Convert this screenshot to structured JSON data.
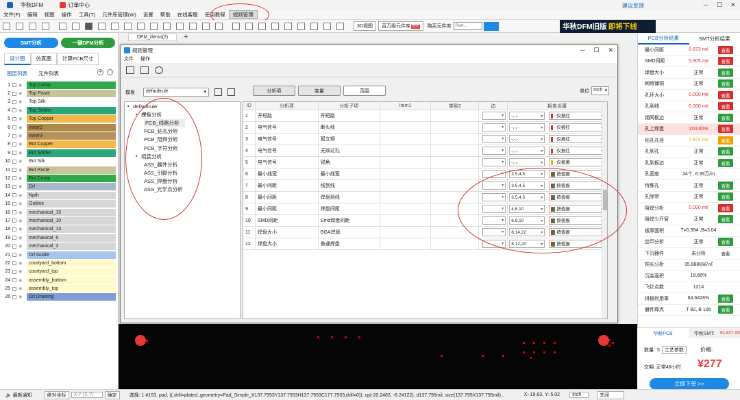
{
  "titlebar": {
    "tab1": "华秋DFM",
    "tab2": "订单中心",
    "feedback": "建议反馈",
    "win": [
      "─",
      "☐",
      "✕"
    ]
  },
  "menu": [
    "文件(F)",
    "编辑",
    "视图",
    "操作",
    "工具(T)",
    "元件库管理(W)",
    "设置",
    "帮助",
    "在线客服",
    "使用教程",
    "规则管理"
  ],
  "toolbar": {
    "btn3d": "3D视图",
    "parts": "百万级元件库",
    "hot": "HOT",
    "buy": "购买元件库",
    "search_ph": "Part..."
  },
  "banner": {
    "part1": "华秋DFM旧版",
    "part2": "即将下线"
  },
  "left": {
    "smt": "SMT分析",
    "dfm": "一键DFM分析",
    "tabs": [
      "设计图",
      "仿真图",
      "计算PCB尺寸"
    ],
    "listtabs": [
      "图层列表",
      "元件列表"
    ],
    "layers": [
      {
        "n": "1",
        "name": "Top Comp",
        "color": "#2eaa4d"
      },
      {
        "n": "2",
        "name": "Top Paste",
        "color": "#c8c49a"
      },
      {
        "n": "3",
        "name": "Top Silk",
        "color": "#ffffff"
      },
      {
        "n": "4",
        "name": "Top Solder",
        "color": "#2aa87a"
      },
      {
        "n": "5",
        "name": "Top Copper",
        "color": "#f4b74a"
      },
      {
        "n": "6",
        "name": "Inner2",
        "color": "#b08a4a"
      },
      {
        "n": "7",
        "name": "Inner3",
        "color": "#b5925a"
      },
      {
        "n": "8",
        "name": "Bot Copper",
        "color": "#f4b74a"
      },
      {
        "n": "9",
        "name": "Bot Solder",
        "color": "#2aa87a"
      },
      {
        "n": "10",
        "name": "Bot Silk",
        "color": "#ffffff"
      },
      {
        "n": "11",
        "name": "Bot Paste",
        "color": "#c8c49a"
      },
      {
        "n": "12",
        "name": "Bot Comp",
        "color": "#2eaa4d"
      },
      {
        "n": "13",
        "name": "Drl",
        "color": "#a9b8c9"
      },
      {
        "n": "14",
        "name": "Npth",
        "color": "#d6d6d6"
      },
      {
        "n": "15",
        "name": "Outline",
        "color": "#d6d6d6"
      },
      {
        "n": "16",
        "name": "mechanical_15",
        "color": "#d6d6d6"
      },
      {
        "n": "17",
        "name": "mechanical_10",
        "color": "#d6d6d6"
      },
      {
        "n": "18",
        "name": "mechanical_13",
        "color": "#d6d6d6"
      },
      {
        "n": "19",
        "name": "mechanical_6",
        "color": "#d6d6d6"
      },
      {
        "n": "20",
        "name": "mechanical_3",
        "color": "#d6d6d6"
      },
      {
        "n": "21",
        "name": "Drl Guide",
        "color": "#a9c4ec"
      },
      {
        "n": "22",
        "name": "courtyard_bottom",
        "color": "#fffbc8"
      },
      {
        "n": "23",
        "name": "courtyard_top",
        "color": "#fffbc8"
      },
      {
        "n": "24",
        "name": "assembly_bottom",
        "color": "#fffbc8"
      },
      {
        "n": "25",
        "name": "assembly_top",
        "color": "#fffbc8"
      },
      {
        "n": "26",
        "name": "Drl Drawing",
        "color": "#7f9ed6"
      }
    ]
  },
  "doc_tab": "DFM_demo(2)",
  "dialog": {
    "title": "规则管理",
    "menu": [
      "文件",
      "操作"
    ],
    "template_label": "模板",
    "template_value": "defaultrule",
    "tabs": [
      "分析项",
      "变量",
      "范围"
    ],
    "unit_label": "单位",
    "unit_value": "Inch",
    "tree": [
      {
        "label": "defaultrule",
        "level": 0,
        "toggle": "▪"
      },
      {
        "label": "裸板分析",
        "level": 1,
        "toggle": "▪"
      },
      {
        "label": "PCB_线路分析",
        "level": 2,
        "sel": true
      },
      {
        "label": "PCB_钻孔分析",
        "level": 2
      },
      {
        "label": "PCB_阻焊分析",
        "level": 2
      },
      {
        "label": "PCB_字符分析",
        "level": 2
      },
      {
        "label": "组装分析",
        "level": 1,
        "toggle": "▪"
      },
      {
        "label": "ASS_器件分析",
        "level": 2
      },
      {
        "label": "ASS_引脚分析",
        "level": 2
      },
      {
        "label": "ASS_焊盘分析",
        "level": 2
      },
      {
        "label": "ASS_光学点分析",
        "level": 2
      }
    ],
    "columns": [
      "ID",
      "分析项",
      "分析子项",
      "Item1",
      "类型2",
      "边",
      "报告设置"
    ],
    "rows": [
      {
        "id": "1",
        "item": "开短路",
        "sub": "开短路",
        "val": "-,-,-",
        "rep": "仅报红",
        "c1": "#d32f2f",
        "c2": ""
      },
      {
        "id": "2",
        "item": "电气信号",
        "sub": "断头线",
        "val": "-,-,-",
        "rep": "仅报红",
        "c1": "#d32f2f",
        "c2": ""
      },
      {
        "id": "3",
        "item": "电气信号",
        "sub": "孤立铜",
        "val": "-,-,-",
        "rep": "仅报红",
        "c1": "#d32f2f",
        "c2": ""
      },
      {
        "id": "4",
        "item": "电气信号",
        "sub": "无效过孔",
        "val": "-,-,-",
        "rep": "仅报红",
        "c1": "#d32f2f",
        "c2": ""
      },
      {
        "id": "5",
        "item": "电气信号",
        "sub": "锐角",
        "val": "-,-,-",
        "rep": "仅报黄",
        "c1": "#e8b400",
        "c2": ""
      },
      {
        "id": "6",
        "item": "最小线宽",
        "sub": "最小线宽",
        "val": "3.5,4,5",
        "rep": "按值报",
        "c1": "#d32f2f",
        "c2": "#e8b400"
      },
      {
        "id": "7",
        "item": "最小间距",
        "sub": "线到线",
        "val": "3.5,4,5",
        "rep": "按值报",
        "c1": "#d32f2f",
        "c2": "#e8b400"
      },
      {
        "id": "8",
        "item": "最小间距",
        "sub": "焊盘到线",
        "val": "3.5,4,5",
        "rep": "按值报",
        "c1": "#d32f2f",
        "c2": "#e8b400"
      },
      {
        "id": "9",
        "item": "最小间距",
        "sub": "焊盘间距",
        "val": "4,6,10",
        "rep": "按值报",
        "c1": "#d32f2f",
        "c2": "#e8b400"
      },
      {
        "id": "10",
        "item": "SMD间距",
        "sub": "Smd焊盘间距",
        "val": "6,8,10",
        "rep": "按值报",
        "c1": "#d32f2f",
        "c2": "#e8b400"
      },
      {
        "id": "11",
        "item": "焊盘大小",
        "sub": "BGA焊盘",
        "val": "8,14,22",
        "rep": "按值报",
        "c1": "#d32f2f",
        "c2": "#e8b400"
      },
      {
        "id": "12",
        "item": "焊盘大小",
        "sub": "普通焊盘",
        "val": "8,12,20",
        "rep": "按值报",
        "c1": "#d32f2f",
        "c2": "#e8b400"
      }
    ]
  },
  "right": {
    "tabs": [
      "PCB分析结果",
      "SMT分析结果"
    ],
    "metrics": [
      {
        "name": "最小间距",
        "val": "0.673 mil",
        "vc": "#d32f2f",
        "btn": "查看",
        "bc": "#d32f2f"
      },
      {
        "name": "SMD间距",
        "val": "5.905 mil",
        "vc": "#d32f2f",
        "btn": "查看",
        "bc": "#d32f2f"
      },
      {
        "name": "焊盘大小",
        "val": "正常",
        "vc": "#222",
        "btn": "查看",
        "bc": "#2e9b3e"
      },
      {
        "name": "网络铺铜",
        "val": "正常",
        "vc": "#222",
        "btn": "查看",
        "bc": "#2e9b3e"
      },
      {
        "name": "孔环大小",
        "val": "0.000 mil",
        "vc": "#d32f2f",
        "btn": "查看",
        "bc": "#d32f2f"
      },
      {
        "name": "孔到线",
        "val": "0.000 mil",
        "vc": "#d32f2f",
        "btn": "查看",
        "bc": "#d32f2f"
      },
      {
        "name": "钢网板边",
        "val": "正常",
        "vc": "#222",
        "btn": "查看",
        "bc": "#2e9b3e"
      },
      {
        "name": "孔上焊盘",
        "val": "100.00%",
        "vc": "#d32f2f",
        "btn": "查看",
        "bc": "#d32f2f",
        "hl": true
      },
      {
        "name": "钻孔孔径",
        "val": "7.874 mil",
        "vc": "#f0a000",
        "btn": "查看",
        "bc": "#f0a000"
      },
      {
        "name": "孔到孔",
        "val": "正常",
        "vc": "#222",
        "btn": "查看",
        "bc": "#2e9b3e"
      },
      {
        "name": "孔到板边",
        "val": "正常",
        "vc": "#222",
        "btn": "查看",
        "bc": "#2e9b3e"
      },
      {
        "name": "孔密度",
        "val": "34个, 6.39万/m",
        "vc": "#222",
        "btn": "",
        "bc": ""
      },
      {
        "name": "特殊孔",
        "val": "正常",
        "vc": "#222",
        "btn": "查看",
        "bc": "#2e9b3e"
      },
      {
        "name": "孔除常",
        "val": "正常",
        "vc": "#222",
        "btn": "查看",
        "bc": "#2e9b3e"
      },
      {
        "name": "阻焊分析",
        "val": "0.000 mil",
        "vc": "#d32f2f",
        "btn": "查看",
        "bc": "#d32f2f"
      },
      {
        "name": "阻焊少开窗",
        "val": "正常",
        "vc": "#222",
        "btn": "查看",
        "bc": "#2e9b3e"
      },
      {
        "name": "板厚面积",
        "val": "T=5.994 ,B=3.04",
        "vc": "#222",
        "btn": "",
        "bc": ""
      },
      {
        "name": "丝印分析",
        "val": "正常",
        "vc": "#222",
        "btn": "查看",
        "bc": "#2e9b3e"
      },
      {
        "name": "下沉器件",
        "val": "未分析",
        "vc": "#222",
        "btn": "查看",
        "bc": ""
      },
      {
        "name": "铜长分析",
        "val": "35.8888米/㎡",
        "vc": "#222",
        "btn": "",
        "bc": ""
      },
      {
        "name": "沉金面积",
        "val": "18.68%",
        "vc": "#222",
        "btn": "",
        "bc": ""
      },
      {
        "name": "飞针点数",
        "val": "1214",
        "vc": "#222",
        "btn": "",
        "bc": ""
      },
      {
        "name": "拼板利用率",
        "val": "84.6426%",
        "vc": "#222",
        "btn": "查看",
        "bc": "#2e9b3e"
      },
      {
        "name": "器件焊点",
        "val": "T 82, B 106",
        "vc": "#222",
        "btn": "查看",
        "bc": "#2e9b3e"
      }
    ],
    "card": {
      "tab1": "华秋PCB",
      "tab2": "华秋SMT:",
      "tab2_price": "¥1437.00",
      "qty_label": "数量:",
      "qty": "5",
      "qty_btn": "工艺参数",
      "price_label": "价格:",
      "delivery": "交期: 正常48小时",
      "price": "¥277",
      "order": "立即下单 >>"
    }
  },
  "status": {
    "notice": "最新通知",
    "abs": "绝对坐标",
    "xy_ph": "X:Y (X,Y)",
    "ok": "确定",
    "selection": "选择: 1 #153, pad, ((.drill=plated,.geometry=Pad_Simple_X137.7953Y137.7953H137.7953C177.7953,drill=0)), cp(-20.2483, -8.24122), d137.795mil, size(137.795X137.795mil)...",
    "coord": "X:-19.63, Y:-5.02",
    "unit": "Inch",
    "close": "关闭"
  }
}
